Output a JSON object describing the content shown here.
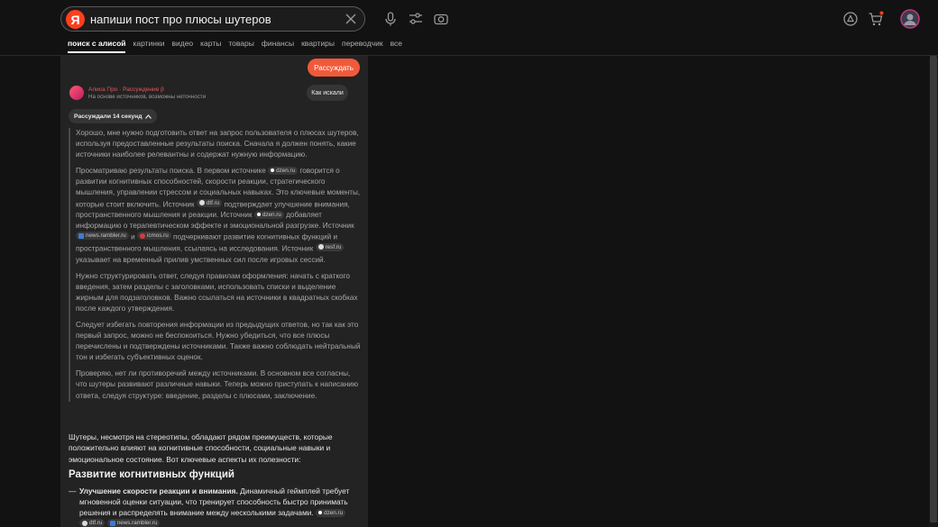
{
  "search": {
    "logo": "Я",
    "query": "напиши пост про плюсы шутеров"
  },
  "tabs": [
    {
      "label": "поиск с алисой",
      "active": true
    },
    {
      "label": "картинки"
    },
    {
      "label": "видео"
    },
    {
      "label": "карты"
    },
    {
      "label": "товары"
    },
    {
      "label": "финансы"
    },
    {
      "label": "квартиры"
    },
    {
      "label": "переводчик"
    },
    {
      "label": "все"
    }
  ],
  "panel": {
    "reason_button": "Рассуждать",
    "alisa_title": "Алиса Про · Рассуждение β",
    "alisa_subtitle": "На основе источников, возможны неточности",
    "how_button": "Как искали",
    "thought_toggle": "Рассуждали 14 секунд"
  },
  "thoughts": {
    "p1": "Хорошо, мне нужно подготовить ответ на запрос пользователя о плюсах шутеров, используя предоставленные результаты поиска. Сначала я должен понять, какие источники наиболее релевантны и содержат нужную информацию.",
    "p2": {
      "t1": "Просматриваю результаты поиска. В первом источнике",
      "t2": "говорится о развитии когнитивных способностей, скорости реакции, стратегического мышления, управлении стрессом и социальных навыках. Это ключевые моменты, которые стоит включить. Источник",
      "t3": "подтверждает улучшение внимания, пространственного мышления и реакции. Источник",
      "t4": "добавляет информацию о терапевтическом эффекте и эмоциональной разгрузке. Источник",
      "t5": "и",
      "t6": "подчеркивают развитие когнитивных функций и пространственного мышления, ссылаясь на исследования. Источник",
      "t7": "указывает на временный прилив умственных сил после игровых сессий."
    },
    "p3": "Нужно структурировать ответ, следуя правилам оформления: начать с краткого введения, затем разделы с заголовками, использовать списки и выделение жирным для подзаголовков. Важно ссылаться на источники в квадратных скобках после каждого утверждения.",
    "p4": "Следует избегать повторения информации из предыдущих ответов, но так как это первый запрос, можно не беспокоиться. Нужно убедиться, что все плюсы перечислены и подтверждены источниками. Также важно соблюдать нейтральный тон и избегать субъективных оценок.",
    "p5": "Проверяю, нет ли противоречий между источниками. В основном все согласны, что шутеры развивают различные навыки. Теперь можно приступать к написанию ответа, следуя структуре: введение, разделы с плюсами, заключение."
  },
  "sources": {
    "dzen": "dzen.ru",
    "dtf": "dtf.ru",
    "rambler": "news.rambler.ru",
    "icmos": "icmos.ru",
    "resf": "resf.ru"
  },
  "answer": {
    "intro": "Шутеры, несмотря на стереотипы, обладают рядом преимуществ, которые положительно влияют на когнитивные способности, социальные навыки и эмоциональное состояние. Вот ключевые аспекты их полезности:",
    "heading": "Развитие когнитивных функций",
    "item1_dash": "—",
    "item1_bold": "Улучшение скорости реакции и внимания.",
    "item1_text": "Динамичный геймплей требует мгновенной оценки ситуации, что тренирует способность быстро принимать решения и распределять внимание между несколькими задачами."
  },
  "colors": {
    "accent": "#f05a3a",
    "background": "#121212",
    "panel": "#232323"
  }
}
